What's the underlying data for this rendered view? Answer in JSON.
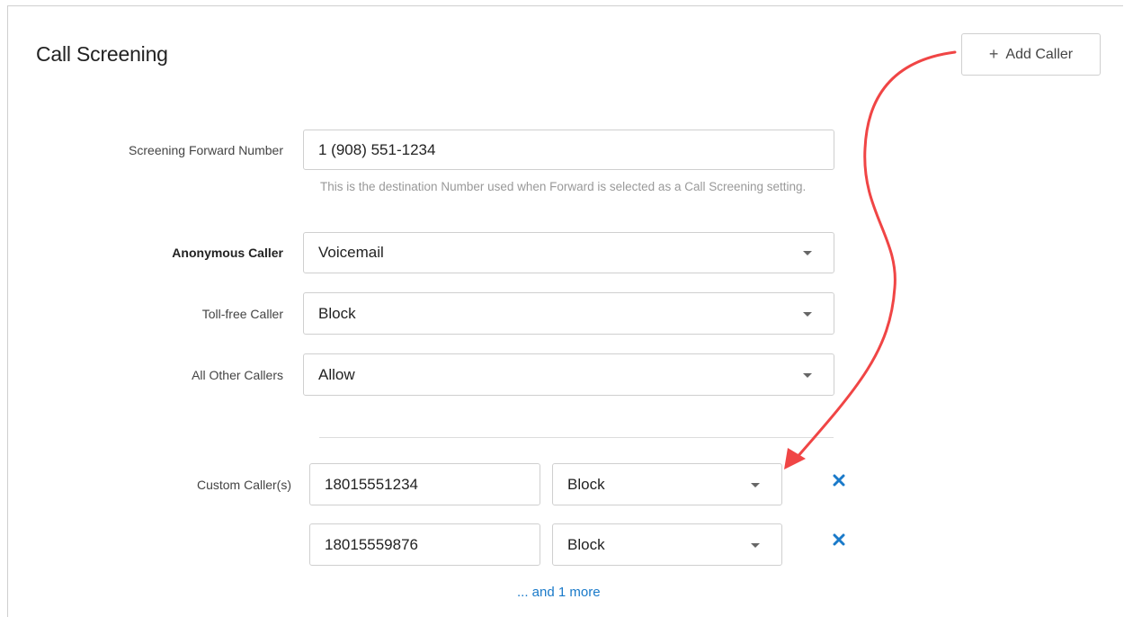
{
  "header": {
    "title": "Call Screening",
    "add_caller_label": "Add Caller"
  },
  "form": {
    "forward": {
      "label": "Screening Forward Number",
      "value": "1 (908) 551-1234",
      "help": "This is the destination Number used when Forward is selected as a Call Screening setting."
    },
    "anonymous": {
      "label": "Anonymous Caller",
      "value": "Voicemail"
    },
    "toll_free": {
      "label": "Toll-free Caller",
      "value": "Block"
    },
    "other": {
      "label": "All Other Callers",
      "value": "Allow"
    },
    "custom": {
      "label": "Custom Caller(s)",
      "rows": [
        {
          "number": "18015551234",
          "action": "Block"
        },
        {
          "number": "18015559876",
          "action": "Block"
        }
      ],
      "more_label": "... and 1 more"
    }
  },
  "colors": {
    "accent": "#1a7ac9",
    "annotation_arrow": "#f04545"
  }
}
